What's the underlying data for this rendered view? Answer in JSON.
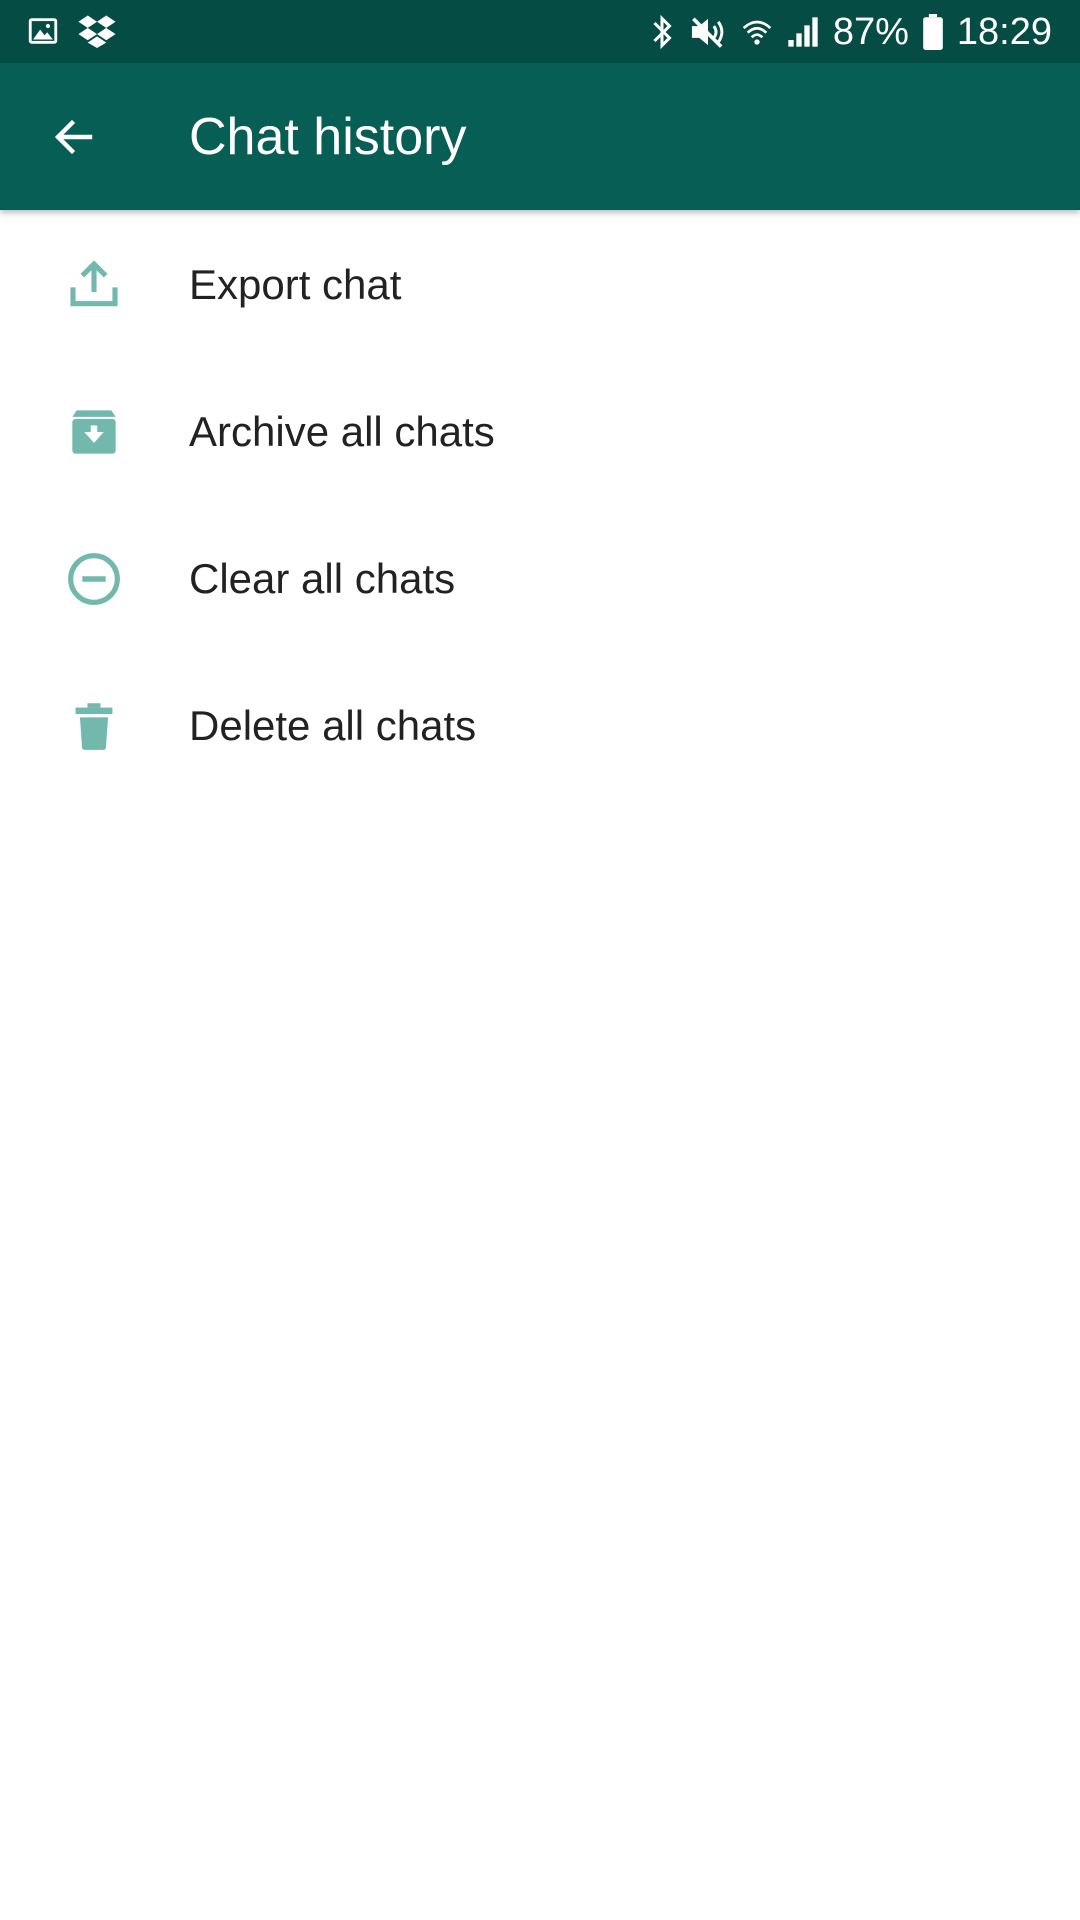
{
  "status_bar": {
    "left_icons": [
      "gallery-icon",
      "dropbox-icon"
    ],
    "right_icons": [
      "bluetooth-icon",
      "mute-icon",
      "wifi-icon",
      "signal-icon"
    ],
    "battery_percent": "87%",
    "time": "18:29",
    "battery_icon": "battery-icon"
  },
  "app_bar": {
    "title": "Chat history",
    "back_icon": "back-arrow-icon"
  },
  "menu": {
    "items": [
      {
        "label": "Export chat",
        "icon": "export-icon"
      },
      {
        "label": "Archive all chats",
        "icon": "archive-icon"
      },
      {
        "label": "Clear all chats",
        "icon": "clear-icon"
      },
      {
        "label": "Delete all chats",
        "icon": "delete-icon"
      }
    ]
  },
  "colors": {
    "status_bar": "#054d44",
    "app_bar": "#075e54",
    "icon_accent": "#72b8ac",
    "text": "#222222"
  }
}
